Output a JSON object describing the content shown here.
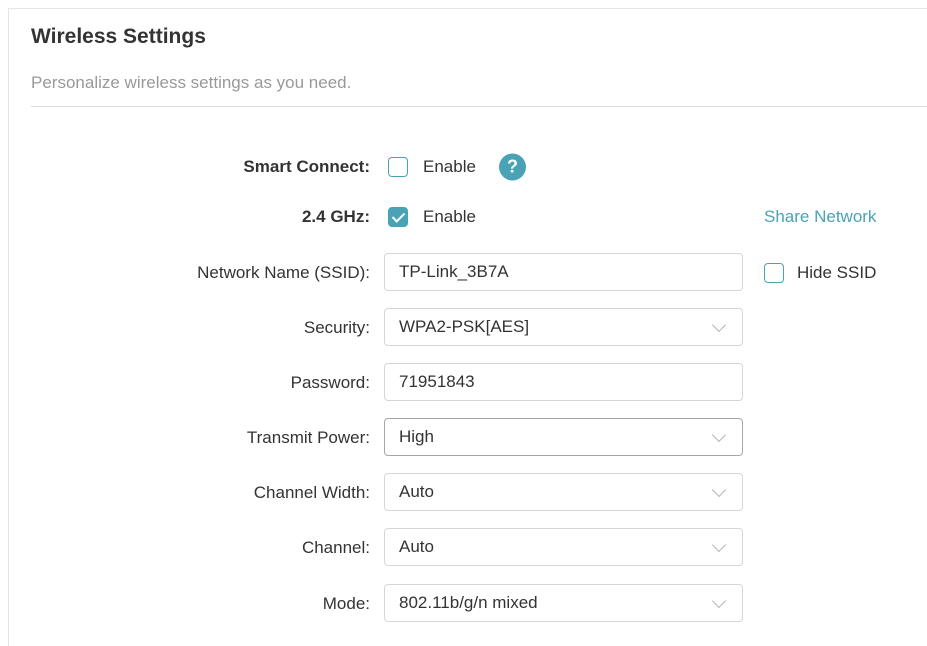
{
  "header": {
    "title": "Wireless Settings",
    "subtitle": "Personalize wireless settings as you need."
  },
  "smart_connect": {
    "label": "Smart Connect:",
    "checkbox_label": "Enable",
    "checked": false,
    "help_glyph": "?"
  },
  "band_24": {
    "label": "2.4 GHz:",
    "checkbox_label": "Enable",
    "checked": true,
    "share_link": "Share Network"
  },
  "ssid": {
    "label": "Network Name (SSID):",
    "value": "TP-Link_3B7A",
    "hide_label": "Hide SSID",
    "hide_checked": false
  },
  "security": {
    "label": "Security:",
    "value": "WPA2-PSK[AES]"
  },
  "password": {
    "label": "Password:",
    "value": "71951843"
  },
  "transmit_power": {
    "label": "Transmit Power:",
    "value": "High"
  },
  "channel_width": {
    "label": "Channel Width:",
    "value": "Auto"
  },
  "channel": {
    "label": "Channel:",
    "value": "Auto"
  },
  "mode": {
    "label": "Mode:",
    "value": "802.11b/g/n mixed"
  },
  "icons": {
    "help": "help-icon",
    "dropdown": "chevron-down-icon",
    "check": "checkmark-icon"
  },
  "colors": {
    "accent": "#4aa3b5",
    "text": "#333333",
    "muted": "#999999",
    "border": "#d6d6d6"
  }
}
